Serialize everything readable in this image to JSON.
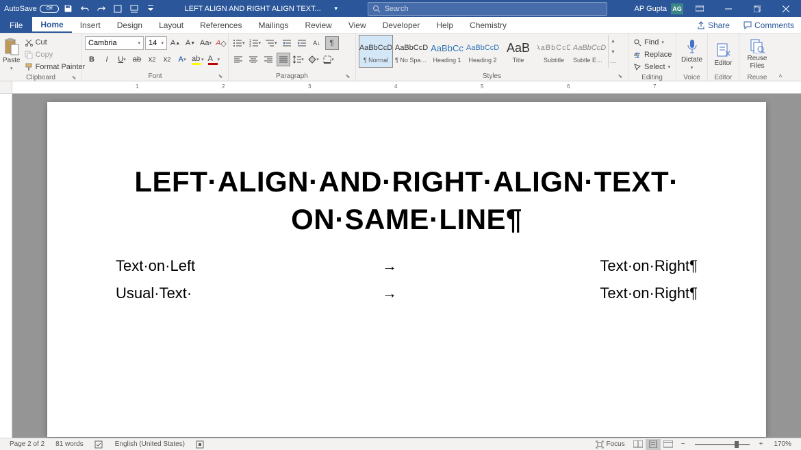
{
  "titlebar": {
    "autosave_label": "AutoSave",
    "autosave_state": "Off",
    "doc_title": "LEFT ALIGN AND RIGHT ALIGN TEXT...",
    "search_placeholder": "Search",
    "user_name": "AP Gupta",
    "user_initials": "AG"
  },
  "tabs": {
    "file": "File",
    "items": [
      "Home",
      "Insert",
      "Design",
      "Layout",
      "References",
      "Mailings",
      "Review",
      "View",
      "Developer",
      "Help",
      "Chemistry"
    ],
    "active_index": 0,
    "share": "Share",
    "comments": "Comments"
  },
  "ribbon": {
    "clipboard": {
      "label": "Clipboard",
      "paste": "Paste",
      "cut": "Cut",
      "copy": "Copy",
      "format_painter": "Format Painter"
    },
    "font": {
      "label": "Font",
      "name": "Cambria",
      "size": "14"
    },
    "paragraph": {
      "label": "Paragraph"
    },
    "styles": {
      "label": "Styles",
      "items": [
        {
          "preview": "AaBbCcD",
          "name": "¶ Normal"
        },
        {
          "preview": "AaBbCcD",
          "name": "¶ No Spac..."
        },
        {
          "preview": "AaBbCc",
          "name": "Heading 1"
        },
        {
          "preview": "AaBbCcD",
          "name": "Heading 2"
        },
        {
          "preview": "AaB",
          "name": "Title"
        },
        {
          "preview": "AaBbCcD",
          "name": "Subtitle"
        },
        {
          "preview": "AaBbCcD",
          "name": "Subtle Em..."
        }
      ]
    },
    "editing": {
      "label": "Editing",
      "find": "Find",
      "replace": "Replace",
      "select": "Select"
    },
    "voice": {
      "label": "Voice",
      "dictate": "Dictate"
    },
    "editor": {
      "label": "Editor",
      "btn": "Editor"
    },
    "reuse": {
      "label": "Reuse Files",
      "btn": "Reuse Files"
    }
  },
  "ruler": {
    "numbers": [
      "1",
      "2",
      "3",
      "4",
      "5",
      "6",
      "7"
    ]
  },
  "document": {
    "title_line1": "LEFT·ALIGN·AND·RIGHT·ALIGN·TEXT·",
    "title_line2": "ON·SAME·LINE¶",
    "rows": [
      {
        "left": "Text·on·Left",
        "tab": "→",
        "right": "Text·on·Right¶"
      },
      {
        "left": "Usual·Text·",
        "tab": "→",
        "right": "Text·on·Right¶"
      }
    ]
  },
  "statusbar": {
    "page": "Page 2 of 2",
    "words": "81 words",
    "language": "English (United States)",
    "focus": "Focus",
    "zoom": "170%"
  }
}
